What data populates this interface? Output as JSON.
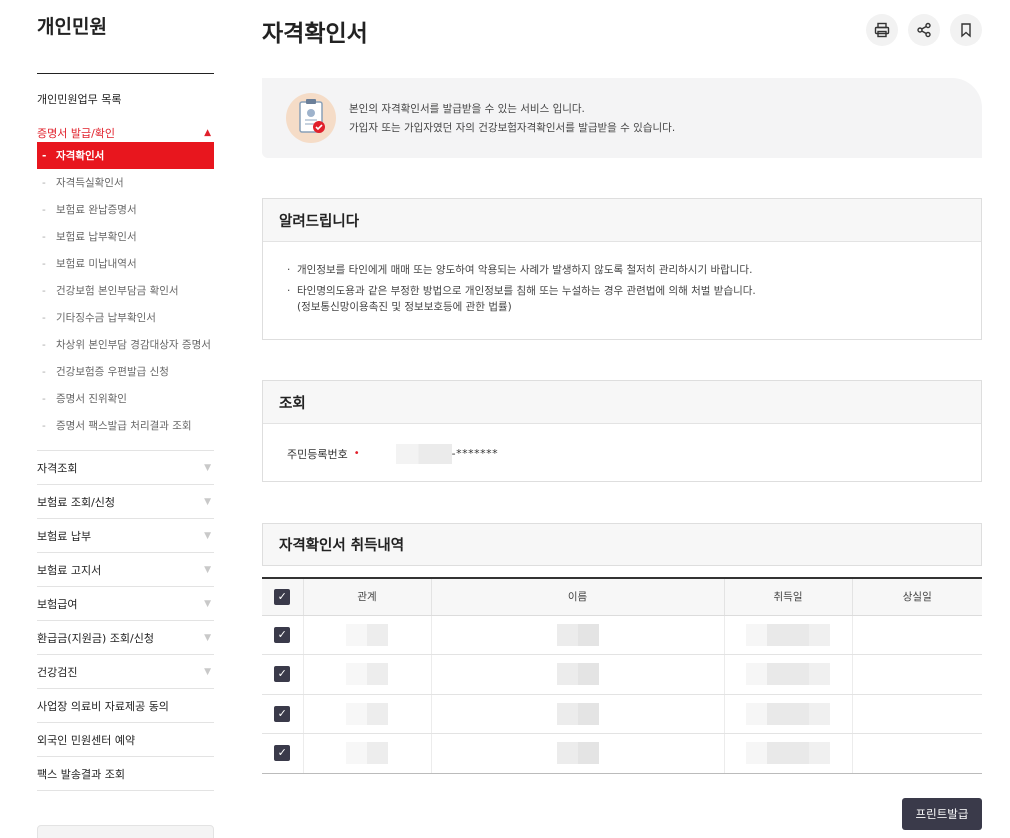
{
  "sidebar": {
    "title": "개인민원",
    "top_item": "개인민원업무 목록",
    "active_group": "증명서 발급/확인",
    "sub_items": [
      "자격확인서",
      "자격득실확인서",
      "보험료 완납증명서",
      "보험료 납부확인서",
      "보험료 미납내역서",
      "건강보험 본인부담금 확인서",
      "기타징수금 납부확인서",
      "차상위 본인부담 경감대상자 증명서",
      "건강보험증 우편발급 신청",
      "증명서 진위확인",
      "증명서 팩스발급 처리결과 조회"
    ],
    "groups": [
      {
        "label": "자격조회",
        "has_arrow": true
      },
      {
        "label": "보험료 조회/신청",
        "has_arrow": true
      },
      {
        "label": "보험료 납부",
        "has_arrow": true
      },
      {
        "label": "보험료 고지서",
        "has_arrow": true
      },
      {
        "label": "보험급여",
        "has_arrow": true
      },
      {
        "label": "환급금(지원금) 조회/신청",
        "has_arrow": true
      },
      {
        "label": "건강검진",
        "has_arrow": true
      },
      {
        "label": "사업장 의료비 자료제공 동의",
        "has_arrow": false
      },
      {
        "label": "외국인 민원센터 예약",
        "has_arrow": false
      },
      {
        "label": "팩스 발송결과 조회",
        "has_arrow": false
      }
    ]
  },
  "page": {
    "title": "자격확인서",
    "tools": [
      "print-icon",
      "share-icon",
      "bookmark-icon"
    ]
  },
  "intro": {
    "line1": "본인의 자격확인서를 발급받을 수 있는 서비스 입니다.",
    "line2": "가입자 또는 가입자였던 자의 건강보험자격확인서를 발급받을 수 있습니다."
  },
  "notice": {
    "title": "알려드립니다",
    "item1": "개인정보를 타인에게 매매 또는 양도하여 악용되는 사례가 발생하지 않도록 철저히 관리하시기 바랍니다.",
    "item2": "타인명의도용과 같은 부정한 방법으로 개인정보를 침해 또는 누설하는 경우 관련법에 의해 처벌 받습니다.",
    "item2_sub": "(정보통신망이용촉진 및 정보보호등에 관한 법률)"
  },
  "query": {
    "title": "조회",
    "label": "주민등록번호",
    "required_mark": "•",
    "masked_tail": "-*******"
  },
  "history": {
    "title": "자격확인서 취득내역",
    "columns": [
      "관계",
      "이름",
      "취득일",
      "상실일"
    ],
    "rows": [
      {
        "checked": true
      },
      {
        "checked": true
      },
      {
        "checked": true
      },
      {
        "checked": true
      }
    ]
  },
  "actions": {
    "print_label": "프린트발급"
  },
  "colors": {
    "accent": "#e8161e",
    "dark_button": "#3a3a4a"
  }
}
